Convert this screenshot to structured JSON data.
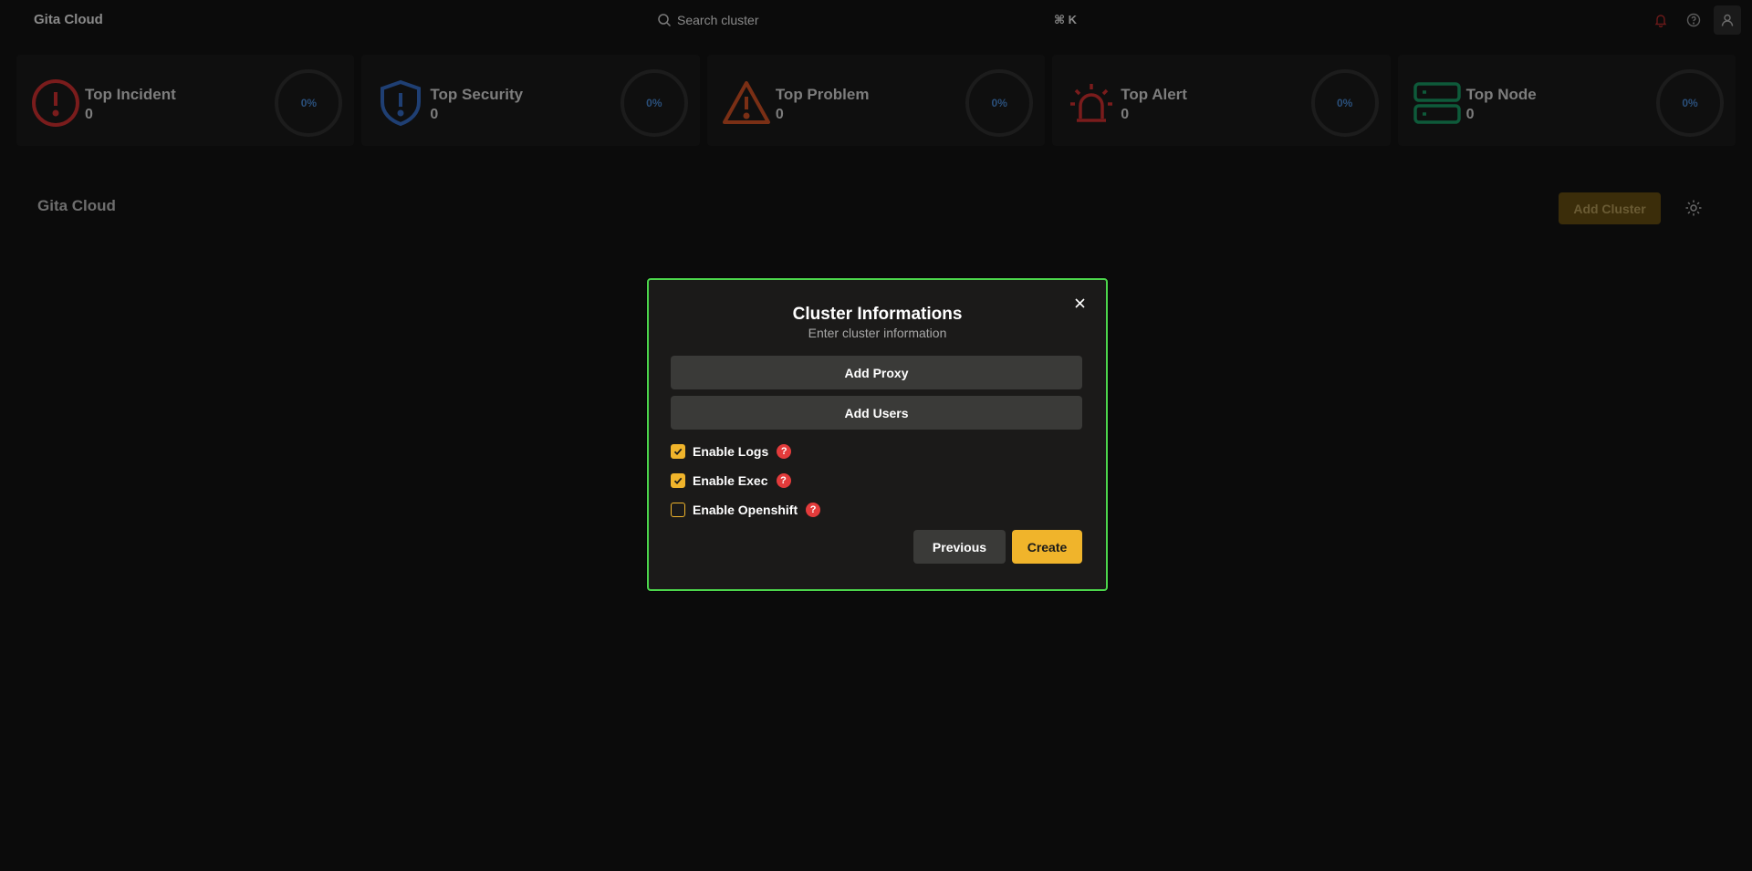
{
  "topbar": {
    "brand": "Gita Cloud",
    "search_placeholder": "Search cluster",
    "search_shortcut": "⌘ K",
    "icons": [
      "bell-icon",
      "help-circle-icon",
      "user-icon"
    ]
  },
  "stats": [
    {
      "title": "Top Incident",
      "count": "0",
      "percent": "0%",
      "icon": "alert-circle-icon",
      "color": "#7a1c1c"
    },
    {
      "title": "Top Security",
      "count": "0",
      "percent": "0%",
      "icon": "shield-icon",
      "color": "#1f3f73"
    },
    {
      "title": "Top Problem",
      "count": "0",
      "percent": "0%",
      "icon": "warning-triangle-icon",
      "color": "#7a2f15"
    },
    {
      "title": "Top Alert",
      "count": "0",
      "percent": "0%",
      "icon": "siren-icon",
      "color": "#7a1c1c"
    },
    {
      "title": "Top Node",
      "count": "0",
      "percent": "0%",
      "icon": "server-icon",
      "color": "#0e5a3a"
    }
  ],
  "main": {
    "section_title": "Gita Cloud",
    "add_cluster_label": "Add Cluster"
  },
  "modal": {
    "title": "Cluster Informations",
    "subtitle": "Enter cluster information",
    "add_proxy_label": "Add Proxy",
    "add_users_label": "Add Users",
    "options": [
      {
        "label": "Enable Logs",
        "checked": true
      },
      {
        "label": "Enable Exec",
        "checked": true
      },
      {
        "label": "Enable Openshift",
        "checked": false
      }
    ],
    "help_glyph": "?",
    "previous_label": "Previous",
    "create_label": "Create"
  },
  "colors": {
    "accent": "#f0b42b",
    "modal_border": "#4cd64c",
    "help_badge": "#e33b3b"
  }
}
